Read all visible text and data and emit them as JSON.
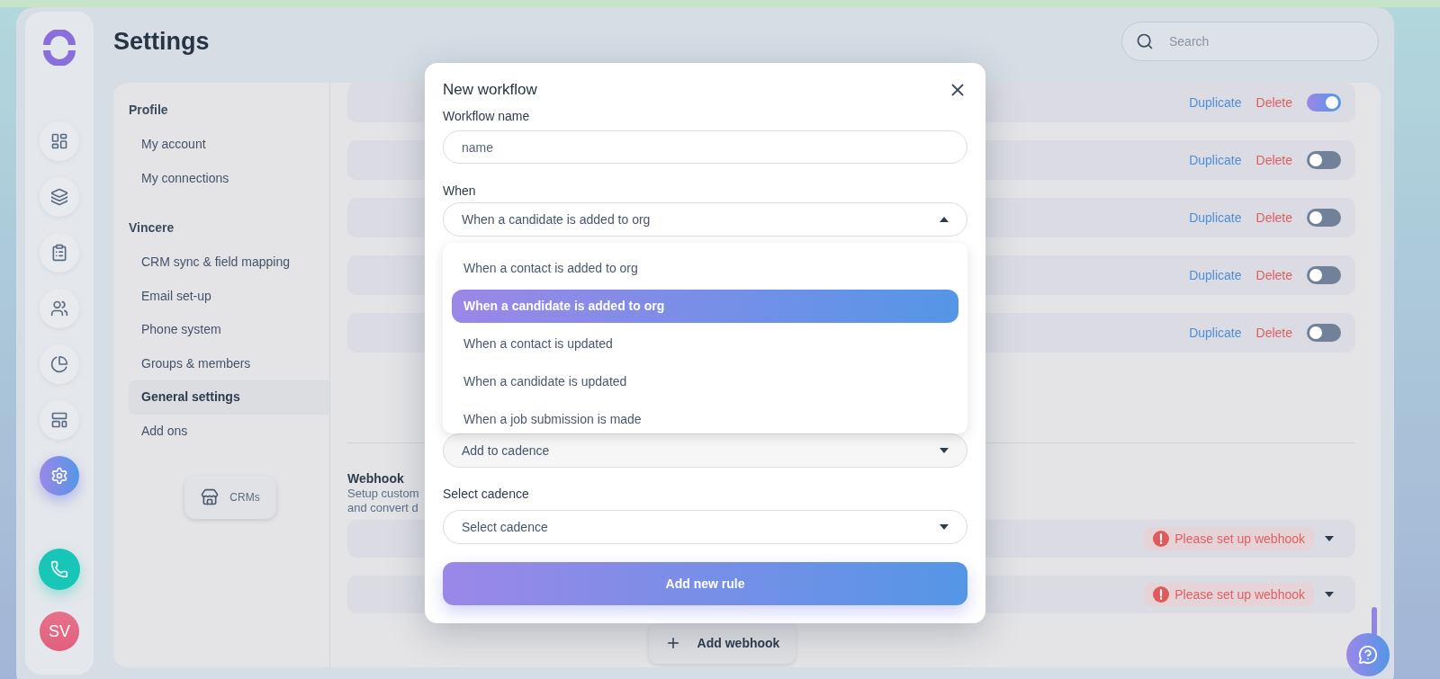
{
  "page": {
    "title": "Settings",
    "search": {
      "placeholder": "Search"
    }
  },
  "rail": {
    "items": [
      {
        "kind": "dashboard",
        "selected": false
      },
      {
        "kind": "stack",
        "selected": false
      },
      {
        "kind": "clipboard",
        "selected": false
      },
      {
        "kind": "people",
        "selected": false
      },
      {
        "kind": "pie",
        "selected": false
      },
      {
        "kind": "layout",
        "selected": false
      },
      {
        "kind": "settings",
        "selected": true
      }
    ],
    "avatar": "SV"
  },
  "settings_nav": {
    "sections": [
      {
        "title": "Profile",
        "items": [
          {
            "label": "My account",
            "selected": false
          },
          {
            "label": "My connections",
            "selected": false
          }
        ]
      },
      {
        "title": "Vincere",
        "items": [
          {
            "label": "CRM sync & field mapping",
            "selected": false
          },
          {
            "label": "Email set-up",
            "selected": false
          },
          {
            "label": "Phone system",
            "selected": false
          },
          {
            "label": "Groups & members",
            "selected": false
          },
          {
            "label": "General settings",
            "selected": true
          },
          {
            "label": "Add ons",
            "selected": false
          }
        ]
      }
    ],
    "crms_button": "CRMs"
  },
  "workflows": [
    {
      "duplicate": "Duplicate",
      "delete": "Delete",
      "on": true
    },
    {
      "duplicate": "Duplicate",
      "delete": "Delete",
      "on": false
    },
    {
      "duplicate": "Duplicate",
      "delete": "Delete",
      "on": false
    },
    {
      "duplicate": "Duplicate",
      "delete": "Delete",
      "on": false
    },
    {
      "duplicate": "Duplicate",
      "delete": "Delete",
      "on": false
    }
  ],
  "webhook": {
    "title": "Webhook",
    "description": [
      "Setup custom",
      "and convert d"
    ],
    "rows": [
      {
        "status": "Please set up webhook"
      },
      {
        "status": "Please set up webhook"
      }
    ],
    "add_button": "Add webhook"
  },
  "modal": {
    "title": "New workflow",
    "name_field": {
      "label": "Workflow name",
      "placeholder": "name"
    },
    "when_field": {
      "label": "When",
      "value": "When a candidate is added to org",
      "expanded": true,
      "options": [
        {
          "label": "When a contact is added to org",
          "selected": false
        },
        {
          "label": "When a candidate is added to org",
          "selected": true
        },
        {
          "label": "When a contact is updated",
          "selected": false
        },
        {
          "label": "When a candidate is updated",
          "selected": false
        },
        {
          "label": "When a job submission is made",
          "selected": false
        }
      ]
    },
    "action_field": {
      "value": "Add to cadence"
    },
    "cadence_field": {
      "label": "Select cadence",
      "placeholder": "Select cadence"
    },
    "submit": "Add new rule"
  }
}
